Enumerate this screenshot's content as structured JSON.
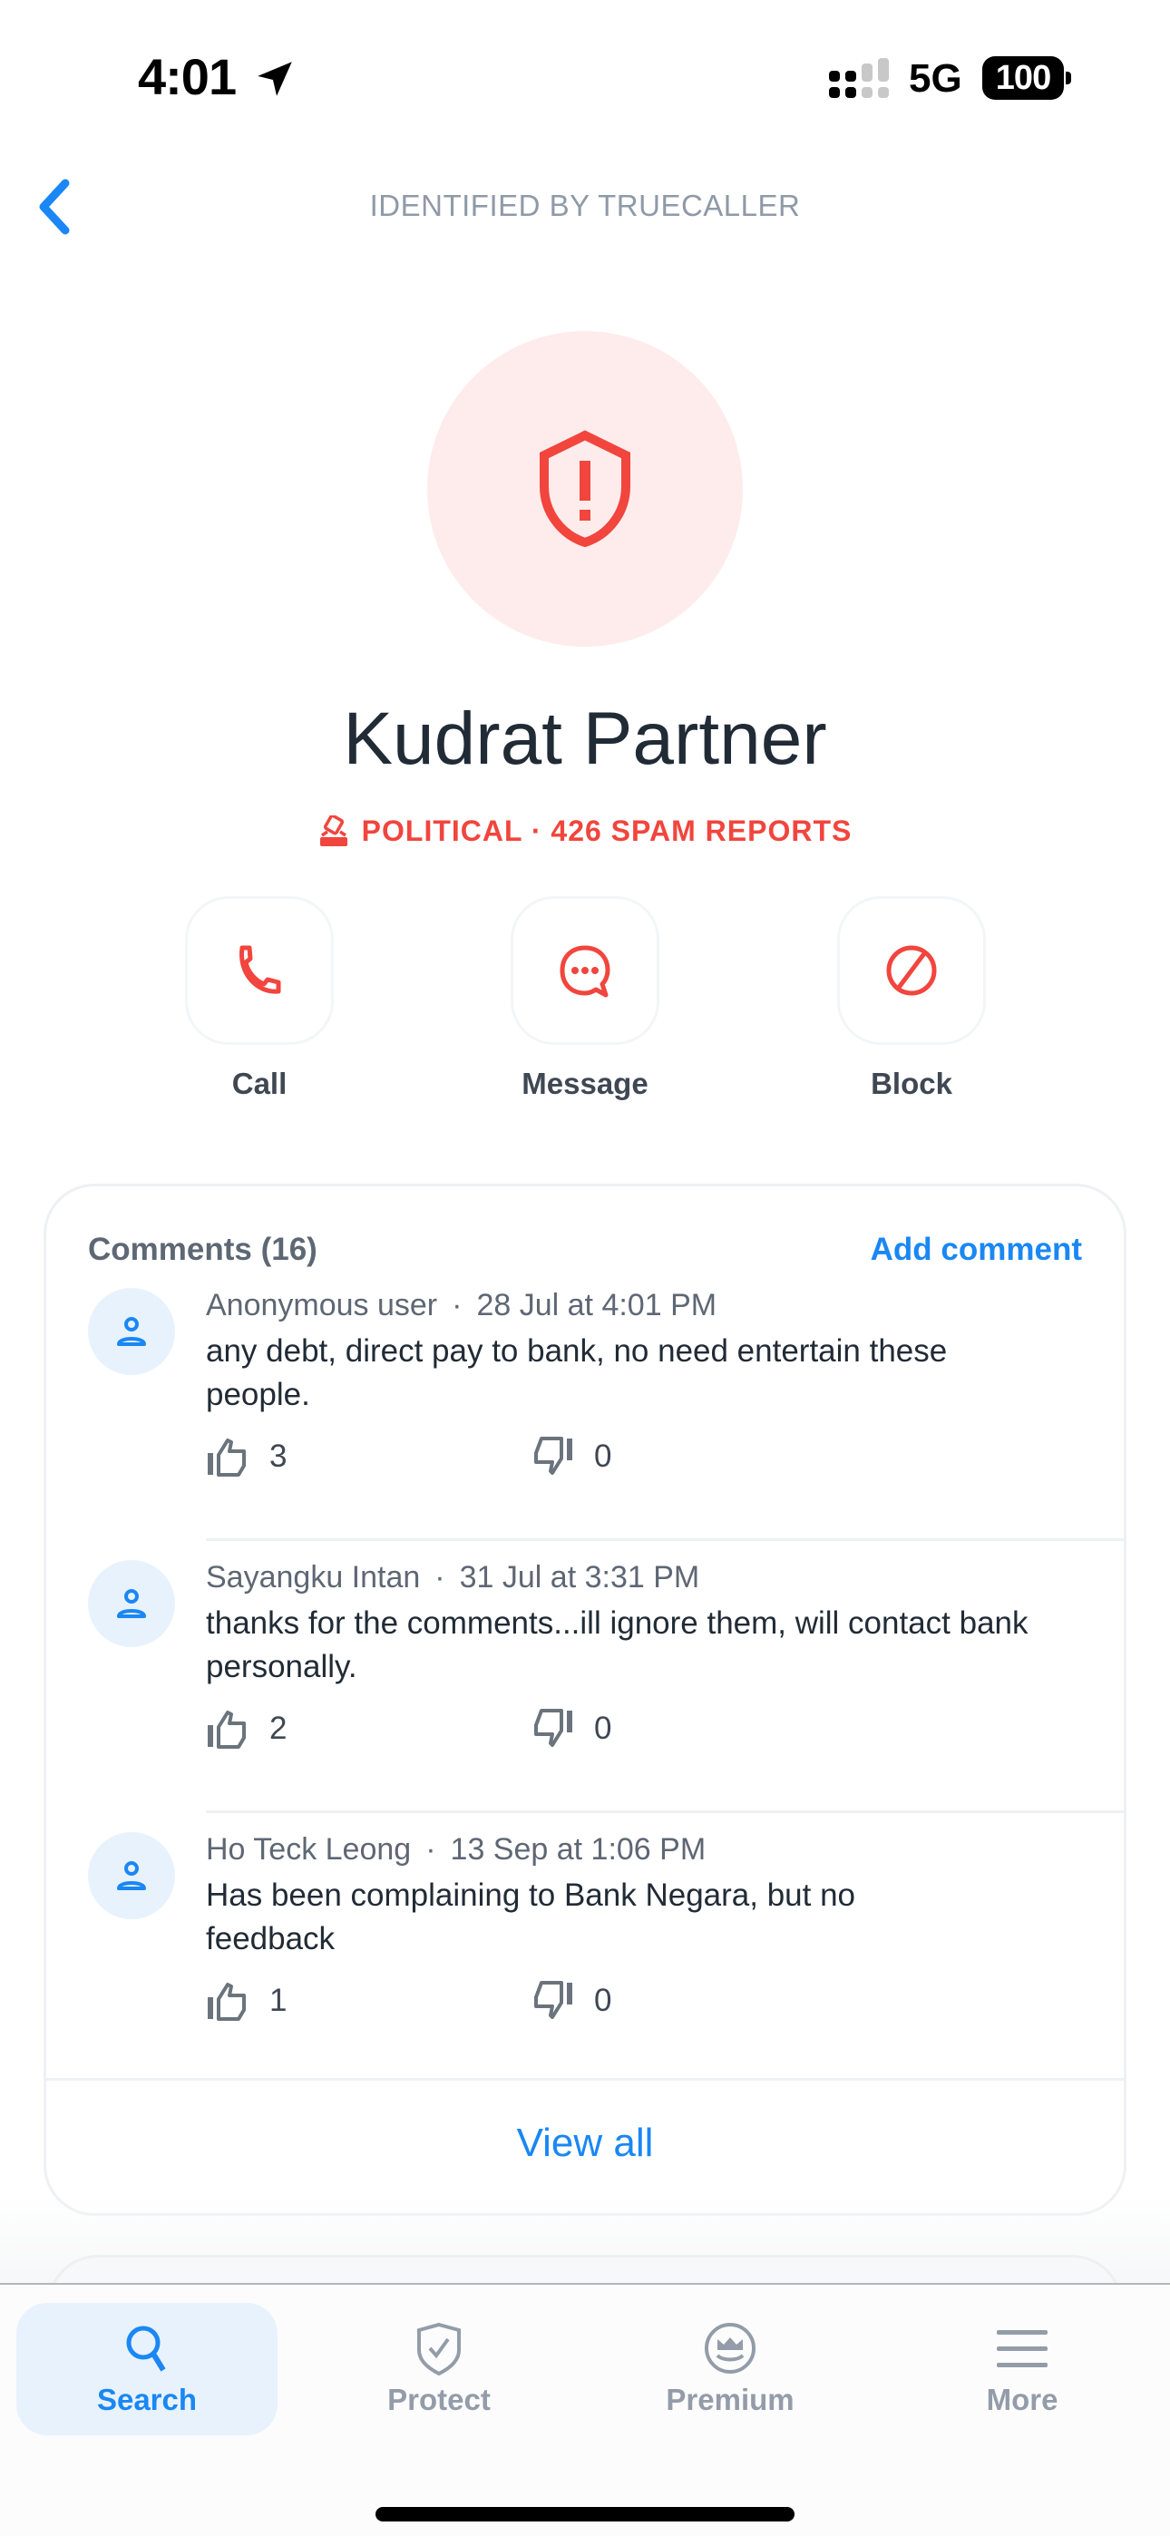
{
  "status_bar": {
    "time": "4:01",
    "network": "5G",
    "battery": "100"
  },
  "header": {
    "title": "IDENTIFIED BY TRUECALLER",
    "back_icon": "chevron-left-icon"
  },
  "profile": {
    "name": "Kudrat Partner",
    "avatar_icon": "shield-alert-icon",
    "spam_label": "POLITICAL · 426 SPAM REPORTS",
    "spam_icon": "ballot-box-icon"
  },
  "actions": [
    {
      "label": "Call",
      "icon": "phone-icon"
    },
    {
      "label": "Message",
      "icon": "chat-bubble-icon"
    },
    {
      "label": "Block",
      "icon": "block-icon"
    }
  ],
  "comments": {
    "title": "Comments (16)",
    "add_label": "Add comment",
    "items": [
      {
        "author": "Anonymous user",
        "date": "28 Jul at 4:01 PM",
        "text": "any debt, direct pay to bank, no need entertain these people.",
        "likes": "3",
        "dislikes": "0"
      },
      {
        "author": "Sayangku Intan",
        "date": "31 Jul at 3:31 PM",
        "text": "thanks for the comments...ill ignore them, will contact bank personally.",
        "likes": "2",
        "dislikes": "0"
      },
      {
        "author": "Ho Teck Leong",
        "date": "13 Sep at 1:06 PM",
        "text": "Has been complaining to Bank Negara, but no feedback",
        "likes": "1",
        "dislikes": "0"
      }
    ],
    "view_all_label": "View all",
    "separator": "·"
  },
  "tab_bar": {
    "tabs": [
      {
        "label": "Search",
        "icon": "search-icon",
        "active": true
      },
      {
        "label": "Protect",
        "icon": "shield-check-icon",
        "active": false
      },
      {
        "label": "Premium",
        "icon": "crown-icon",
        "active": false
      },
      {
        "label": "More",
        "icon": "menu-icon",
        "active": false
      }
    ]
  },
  "colors": {
    "accent": "#1a87f4",
    "spam_red": "#f1453d",
    "avatar_bg": "#fdeceb"
  }
}
